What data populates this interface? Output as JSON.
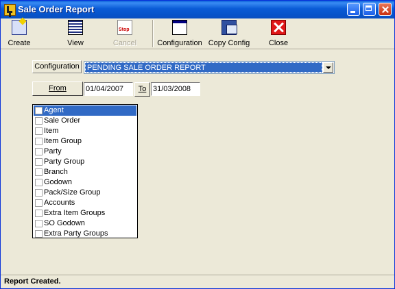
{
  "window": {
    "title": "Sale Order Report"
  },
  "toolbar": {
    "create": "Create",
    "view": "View",
    "cancel": "Cancel",
    "configuration": "Configuration",
    "copy_config": "Copy Config",
    "close": "Close"
  },
  "form": {
    "configuration_label": "Configuration",
    "configuration_value": "PENDING SALE ORDER REPORT",
    "from_label": "From",
    "from_date": "01/04/2007",
    "to_label": "To",
    "to_date": "31/03/2008"
  },
  "list": {
    "items": [
      "Agent",
      "Sale Order",
      "Item",
      "Item Group",
      "Party",
      "Party Group",
      "Branch",
      "Godown",
      "Pack/Size Group",
      "Accounts",
      "Extra Item Groups",
      "SO Godown",
      "Extra Party Groups"
    ],
    "selected": "Agent"
  },
  "status": {
    "text": "Report Created."
  },
  "icons": {
    "create": "create-icon",
    "view": "view-icon",
    "cancel": "stop-icon",
    "configuration": "configuration-icon",
    "copy_config": "copy-config-icon",
    "close": "close-icon"
  },
  "colors": {
    "titlebar": "#0a5bd6",
    "selection": "#316ac5",
    "close_red": "#e01818"
  }
}
